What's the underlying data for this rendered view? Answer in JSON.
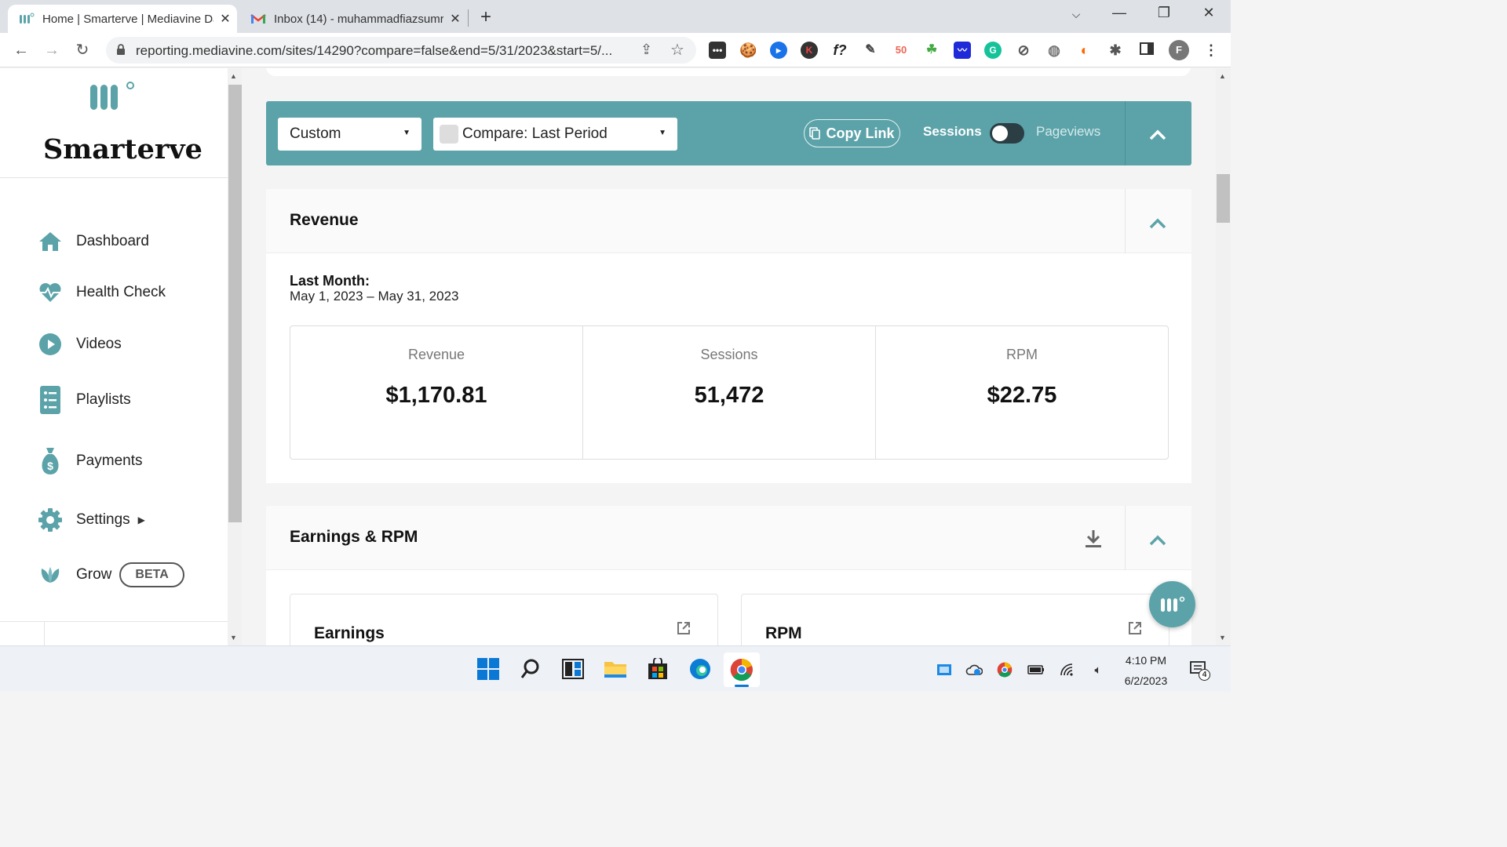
{
  "browser": {
    "tabs": [
      {
        "title": "Home | Smarterve | Mediavine Da",
        "active": true
      },
      {
        "title": "Inbox (14) - muhammadfiazsumr",
        "active": false
      }
    ],
    "url": "reporting.mediavine.com/sites/14290?compare=false&end=5/31/2023&start=5/..."
  },
  "sidebar": {
    "brand": "Smarterve",
    "items": [
      {
        "label": "Dashboard",
        "icon": "home-icon"
      },
      {
        "label": "Health Check",
        "icon": "heartbeat-icon"
      },
      {
        "label": "Videos",
        "icon": "play-icon"
      },
      {
        "label": "Playlists",
        "icon": "list-icon"
      },
      {
        "label": "Payments",
        "icon": "money-bag-icon"
      },
      {
        "label": "Settings",
        "icon": "gear-icon"
      },
      {
        "label": "Grow",
        "icon": "leaf-icon",
        "badge": "BETA"
      }
    ]
  },
  "filters": {
    "range": "Custom",
    "compare": "Compare: Last Period",
    "copy_link": "Copy Link",
    "toggle_left": "Sessions",
    "toggle_right": "Pageviews"
  },
  "revenue": {
    "title": "Revenue",
    "period_label": "Last Month:",
    "period_range": "May 1, 2023 – May 31, 2023",
    "stats": [
      {
        "label": "Revenue",
        "value": "$1,170.81"
      },
      {
        "label": "Sessions",
        "value": "51,472"
      },
      {
        "label": "RPM",
        "value": "$22.75"
      }
    ]
  },
  "earnings": {
    "title": "Earnings & RPM",
    "sub1": "Earnings",
    "sub2": "RPM"
  },
  "taskbar": {
    "time": "4:10 PM",
    "date": "6/2/2023",
    "notifications": "4"
  },
  "colors": {
    "accent": "#5ba3a9",
    "toggle": "#2a3e44"
  }
}
